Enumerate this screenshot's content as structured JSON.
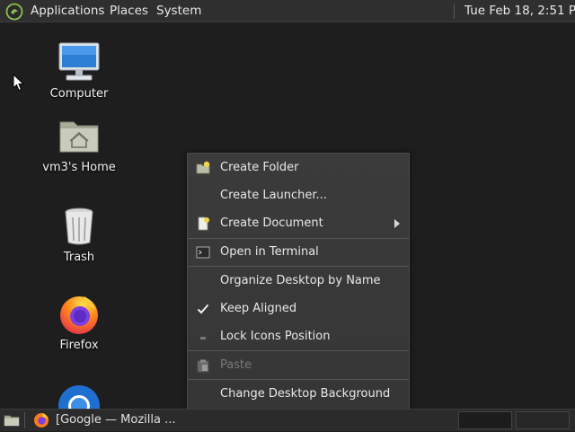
{
  "top_panel": {
    "menus": [
      "Applications",
      "Places",
      "System"
    ],
    "clock": "Tue Feb 18,  2:51 PM",
    "logo_icon": "mate-logo-icon"
  },
  "desktop_icons": [
    {
      "name": "computer",
      "label": "Computer",
      "icon": "monitor-icon"
    },
    {
      "name": "home",
      "label": "vm3's Home",
      "icon": "home-folder-icon"
    },
    {
      "name": "trash",
      "label": "Trash",
      "icon": "trash-icon"
    },
    {
      "name": "firefox",
      "label": "Firefox",
      "icon": "firefox-icon"
    },
    {
      "name": "chromium",
      "label": "",
      "icon": "chromium-icon"
    }
  ],
  "context_menu": {
    "items": [
      {
        "label": "Create Folder",
        "icon": "new-folder-icon",
        "enabled": true
      },
      {
        "label": "Create Launcher...",
        "icon": "",
        "enabled": true
      },
      {
        "label": "Create Document",
        "icon": "new-document-icon",
        "enabled": true,
        "submenu": true
      },
      {
        "label": "Open in Terminal",
        "icon": "terminal-icon",
        "enabled": true
      },
      {
        "label": "Organize Desktop by Name",
        "icon": "",
        "enabled": true
      },
      {
        "label": "Keep Aligned",
        "icon": "checkmark-icon",
        "enabled": true,
        "checked": true
      },
      {
        "label": "Lock Icons Position",
        "icon": "lock-icon",
        "enabled": true
      },
      {
        "label": "Paste",
        "icon": "paste-icon",
        "enabled": false
      },
      {
        "label": "Change Desktop Background",
        "icon": "",
        "enabled": true
      }
    ]
  },
  "bottom_panel": {
    "show_desktop_icon": "show-desktop-icon",
    "tasks": [
      {
        "label": "[Google — Mozilla ...",
        "icon": "firefox-icon"
      }
    ],
    "workspaces": 2
  },
  "colors": {
    "panel_bg": "#2f2f2f",
    "desktop_bg": "#1e1e1e",
    "menu_bg": "#3a3a3a",
    "mate_green": "#8cc152"
  }
}
